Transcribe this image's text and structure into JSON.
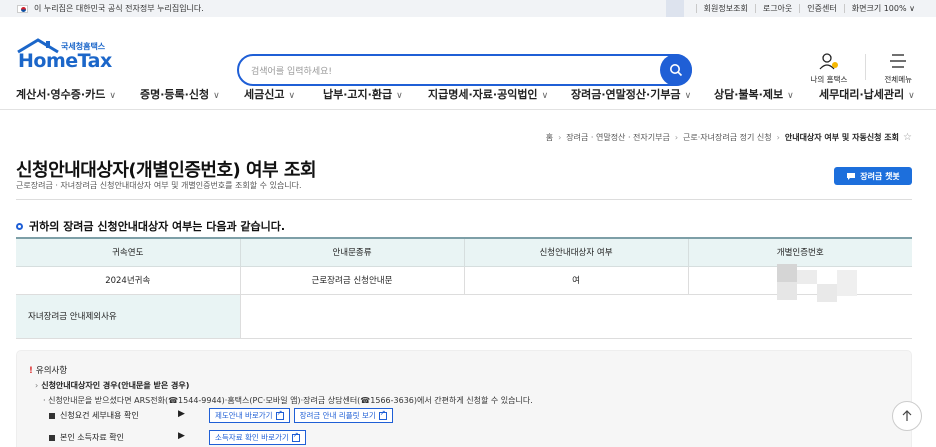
{
  "gov_banner": {
    "text": "이 누리집은 대한민국 공식 전자정부 누리집입니다.",
    "links": [
      "회원정보조회",
      "로그아웃",
      "인증센터",
      "화면크기 100% ∨"
    ]
  },
  "logo": {
    "small": "국세청홈택스",
    "big": "HomeTax"
  },
  "search": {
    "placeholder": "검색어를 입력하세요!"
  },
  "header_right": {
    "my": "나의 홈택스",
    "menu": "전체메뉴"
  },
  "gnb": [
    "계산서·영수증·카드",
    "증명·등록·신청",
    "세금신고",
    "납부·고지·환급",
    "지급명세·자료·공익법인",
    "장려금·연말정산·기부금",
    "상담·불복·제보",
    "세무대리·납세관리"
  ],
  "breadcrumb": {
    "items": [
      "홈",
      "장려금 · 연말정산 · 전자기부금",
      "근로·자녀장려금 정기 신청"
    ],
    "current": "안내대상자 여부 및 자동신청 조회"
  },
  "page": {
    "title": "신청안내대상자(개별인증번호) 여부 조회",
    "subtitle": "근로장려금 · 자녀장려금 신청안내대상자 여부 및 개별인증번호를 조회할 수 있습니다.",
    "chatbot": "장려금 챗봇"
  },
  "result": {
    "heading": "귀하의 장려금 신청안내대상자 여부는 다음과 같습니다.",
    "headers": [
      "귀속연도",
      "안내문종류",
      "신청안내대상자 여부",
      "개별인증번호"
    ],
    "row": [
      "2024년귀속",
      "근로장려금 신청안내문",
      "여"
    ],
    "reason_label": "자녀장려금 안내제외사유"
  },
  "notice": {
    "title": "유의사항",
    "sub": "신청안내대상자인 경우(안내문을 받은 경우)",
    "line": "· 신청안내문을 받으셨다면 ARS전화(☎1544-9944)·홈택스(PC·모바일 앱)·장려금 상담센터(☎1566-3636)에서 간편하게 신청할 수 있습니다.",
    "row1_label": "신청요건 세부내용 확인",
    "row1_btns": [
      "제도안내 바로가기",
      "장려금 안내 리플릿 보기"
    ],
    "row2_label": "본인 소득자료 확인",
    "row2_btns": [
      "소득자료 확인 바로가기"
    ]
  },
  "colors": {
    "brand": "#1f5fd6",
    "table_head": "#e9f4f4",
    "chatbot": "#1d6fdc"
  }
}
